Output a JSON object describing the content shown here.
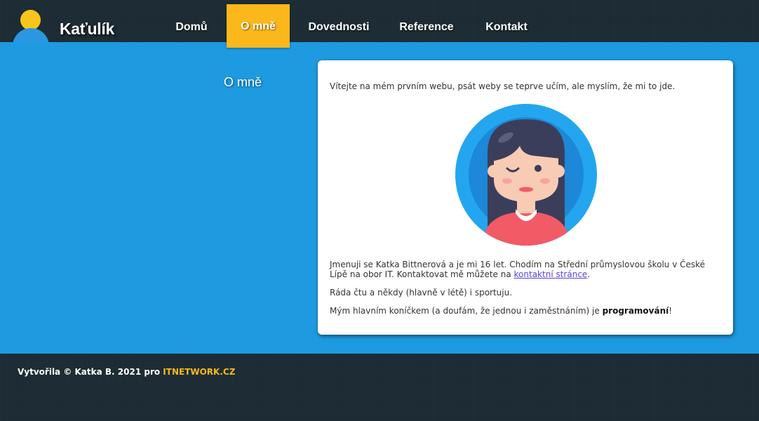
{
  "header": {
    "logo_text": "Kaťulík",
    "logo_icon": "user-avatar-icon"
  },
  "nav": {
    "items": [
      {
        "label": "Domů",
        "active": false
      },
      {
        "label": "O mně",
        "active": true
      },
      {
        "label": "Dovednosti",
        "active": false
      },
      {
        "label": "Reference",
        "active": false
      },
      {
        "label": "Kontakt",
        "active": false
      }
    ]
  },
  "sidebar": {
    "title": "O mně"
  },
  "article": {
    "welcome": "Vítejte na mém prvním webu, psát weby se teprve učím, ale myslím, že mi to jde.",
    "avatar_icon": "girl-avatar-icon",
    "intro_text": "Jmenuji se Katka Bittnerová a je mi 16 let. Chodím na Střední průmyslovou školu v České Lípě na obor IT. Kontaktovat mě můžete na ",
    "contact_link": "kontaktní stránce",
    "intro_end": ".",
    "hobbies": "Ráda čtu a někdy (hlavně v létě) i sportuju.",
    "main_hobby_text": "Mým hlavním koníčkem (a doufám, že jednou i zaměstnáním) je ",
    "main_hobby_bold": "programování",
    "main_hobby_end": "!"
  },
  "footer": {
    "text": "Vytvořila © Katka B. 2021 pro ",
    "link": "ITNETWORK.CZ"
  },
  "colors": {
    "background": "#1e9be0",
    "header_footer": "#1b2a32",
    "accent": "#fcb81a",
    "card": "#ffffff",
    "link": "#5544dd"
  }
}
